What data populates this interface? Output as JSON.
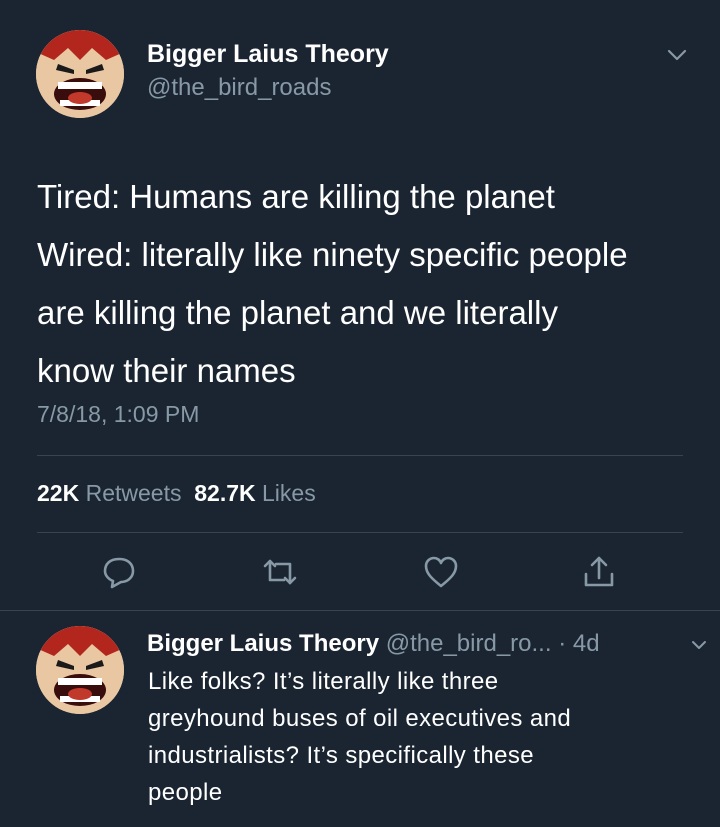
{
  "tweet": {
    "author_name": "Bigger Laius Theory",
    "author_handle": "@the_bird_roads",
    "text_lines": [
      "Tired: Humans are killing the planet",
      "Wired: literally like ninety specific people",
      "are killing the planet and we literally",
      "know their names"
    ],
    "timestamp": "7/8/18, 1:09 PM",
    "retweets_count": "22K",
    "retweets_label": "Retweets",
    "likes_count": "82.7K",
    "likes_label": "Likes",
    "actions": [
      "reply-icon",
      "retweet-icon",
      "like-icon",
      "share-icon"
    ]
  },
  "reply": {
    "author_name": "Bigger Laius Theory",
    "author_handle": "@the_bird_ro...",
    "age": "· 4d",
    "text_lines": [
      "Like folks? It’s literally like three",
      "greyhound buses of oil executives and",
      "industrialists? It’s specifically these",
      "people"
    ]
  },
  "colors": {
    "background": "#1b2532",
    "secondary_text": "#8899a6",
    "divider": "#38444d"
  }
}
